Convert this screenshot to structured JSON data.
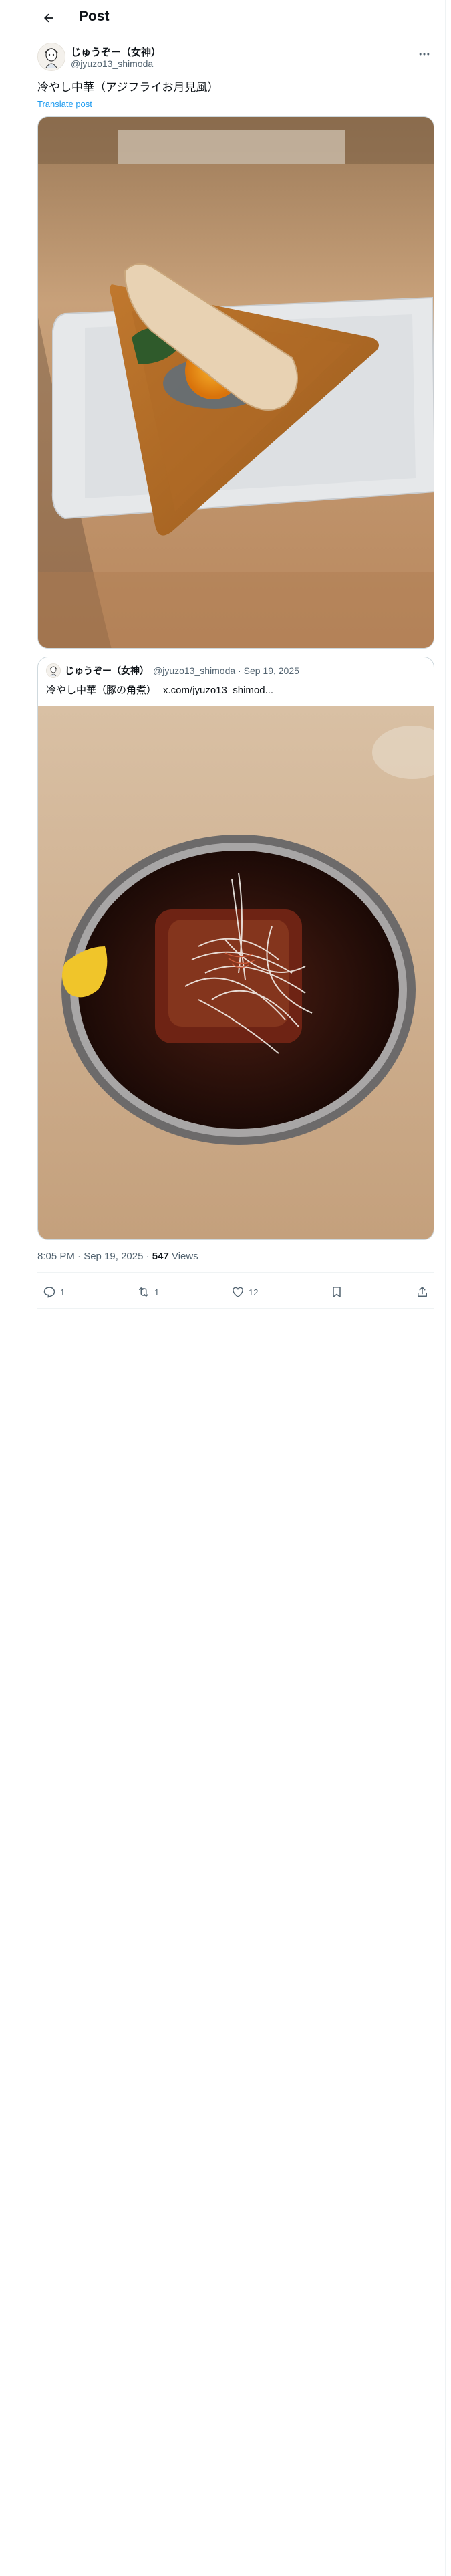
{
  "header": {
    "title": "Post"
  },
  "author": {
    "display_name": "じゅうぞー（女神）",
    "handle": "@jyuzo13_shimoda"
  },
  "post": {
    "text": "冷やし中華（アジフライお月見風）",
    "translate_label": "Translate post"
  },
  "quote": {
    "display_name": "じゅうぞー（女神）",
    "meta": "@jyuzo13_shimoda · Sep 19, 2025",
    "text": "冷やし中華（豚の角煮）",
    "link": "x.com/jyuzo13_shimod..."
  },
  "meta": {
    "time": "8:05 PM · Sep 19, 2025 · ",
    "views_count": "547",
    "views_label": " Views"
  },
  "actions": {
    "replies": "1",
    "reposts": "1",
    "likes": "12"
  },
  "icons": [
    "back-arrow-icon",
    "more-icon",
    "reply-icon",
    "repost-icon",
    "like-icon",
    "bookmark-icon",
    "share-icon"
  ],
  "colors": {
    "accent": "#1d9bf0",
    "text": "#0f1419",
    "muted": "#536471",
    "border": "#cfd9de"
  }
}
